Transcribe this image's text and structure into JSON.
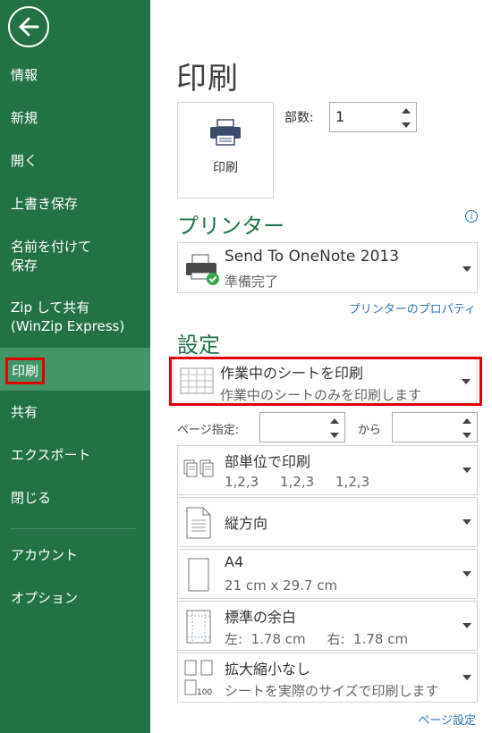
{
  "sidebar": {
    "items": [
      {
        "label": "情報"
      },
      {
        "label": "新規"
      },
      {
        "label": "開く"
      },
      {
        "label": "上書き保存"
      },
      {
        "label": "名前を付けて\n保存"
      },
      {
        "label": "Zip して共有\n(WinZip Express)"
      },
      {
        "label": "印刷"
      },
      {
        "label": "共有"
      },
      {
        "label": "エクスポート"
      },
      {
        "label": "閉じる"
      },
      {
        "label": "アカウント"
      },
      {
        "label": "オプション"
      }
    ]
  },
  "main": {
    "title": "印刷",
    "print_button_label": "印刷",
    "copies_label": "部数:",
    "copies_value": "1",
    "printer_heading": "プリンター",
    "printer": {
      "name": "Send To OneNote 2013",
      "status": "準備完了",
      "icon": "printer-icon"
    },
    "printer_properties_link": "プリンターのプロパティ",
    "settings_heading": "設定",
    "settings": {
      "print_what": {
        "title": "作業中のシートを印刷",
        "subtitle": "作業中のシートのみを印刷します"
      },
      "pages_label": "ページ指定:",
      "pages_to_label": "から",
      "collation": {
        "title": "部単位で印刷",
        "subtitle": "1,2,3     1,2,3     1,2,3"
      },
      "orientation": {
        "title": "縦方向"
      },
      "paper_size": {
        "title": "A4",
        "subtitle": "21 cm x 29.7 cm"
      },
      "margins": {
        "title": "標準の余白",
        "subtitle": "左:  1.78 cm     右:  1.78 cm"
      },
      "scaling": {
        "title": "拡大縮小なし",
        "subtitle": "シートを実際のサイズで印刷します",
        "icon_number": "100"
      }
    },
    "page_setup_link": "ページ設定"
  },
  "colors": {
    "sidebar_bg": "#217346",
    "sidebar_active": "#439467",
    "accent_green": "#217346",
    "link_blue": "#2e75b6",
    "highlight_red": "#e00000"
  }
}
